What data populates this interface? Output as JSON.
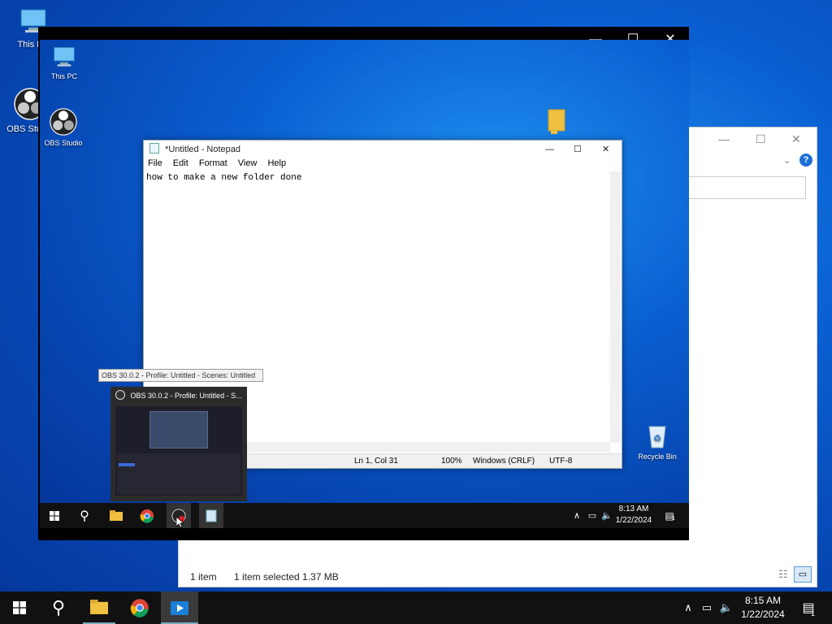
{
  "desktop": {
    "icons": [
      {
        "label": "This PC"
      },
      {
        "label": "OBS Studio"
      }
    ]
  },
  "explorer": {
    "status_items": "1 item",
    "status_selected": "1 item selected  1.37 MB",
    "help_symbol": "?"
  },
  "recording": {
    "desktop_icons": [
      {
        "label": "This PC"
      },
      {
        "label": "OBS Studio"
      },
      {
        "label": "Recycle Bin"
      }
    ],
    "notepad": {
      "title": "*Untitled - Notepad",
      "menu": [
        "File",
        "Edit",
        "Format",
        "View",
        "Help"
      ],
      "content": "how to make a new folder done",
      "status": {
        "position": "Ln 1, Col 31",
        "zoom": "100%",
        "line_ending": "Windows (CRLF)",
        "encoding": "UTF-8"
      }
    },
    "obs_tooltip": "OBS 30.0.2 - Profile: Untitled - Scenes: Untitled",
    "obs_preview_title": "OBS 30.0.2 - Profile: Untitled - S...",
    "taskbar": {
      "time": "8:13 AM",
      "date": "1/22/2024",
      "notifications": "1"
    }
  },
  "taskbar": {
    "time": "8:15 AM",
    "date": "1/22/2024",
    "notifications": "1"
  },
  "colors": {
    "accent": "#0a5fd0",
    "taskbar": "#111111"
  }
}
